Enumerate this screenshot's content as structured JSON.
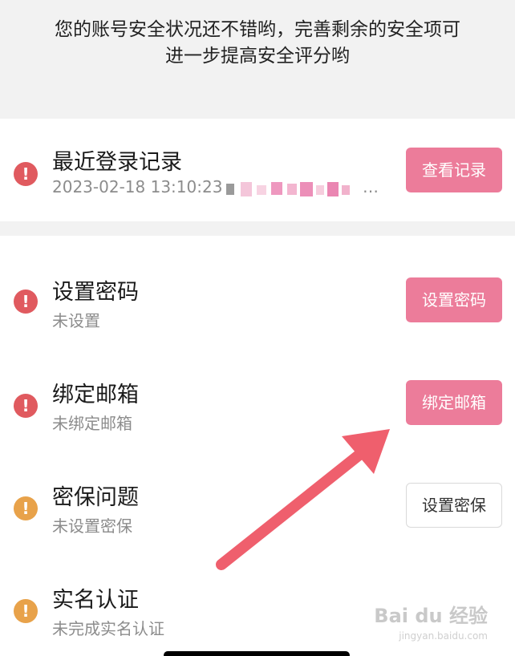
{
  "notice": {
    "line1": "您的账号安全状况还不错哟，完善剩余的安全项可",
    "line2": "进一步提高安全评分哟"
  },
  "login_record": {
    "title": "最近登录记录",
    "detail": "2023-02-18 13:10:23",
    "ellipsis": "…",
    "button": "查看记录"
  },
  "items": [
    {
      "title": "设置密码",
      "status": "未设置",
      "button": "设置密码",
      "level": "red"
    },
    {
      "title": "绑定邮箱",
      "status": "未绑定邮箱",
      "button": "绑定邮箱",
      "level": "red"
    },
    {
      "title": "密保问题",
      "status": "未设置密保",
      "button": "设置密保",
      "level": "orange"
    },
    {
      "title": "实名认证",
      "status": "未完成实名认证",
      "button": "",
      "level": "orange"
    }
  ],
  "icons": {
    "warning": "exclamation-circle-icon",
    "warning_glyph": "!"
  },
  "colors": {
    "danger": "#e05a5f",
    "caution": "#e8a24a",
    "primary_button": "#ec7c9a",
    "arrow": "#ef5f6d"
  },
  "watermark": {
    "brand": "Bai du 经验",
    "url": "jingyan.baidu.com"
  }
}
